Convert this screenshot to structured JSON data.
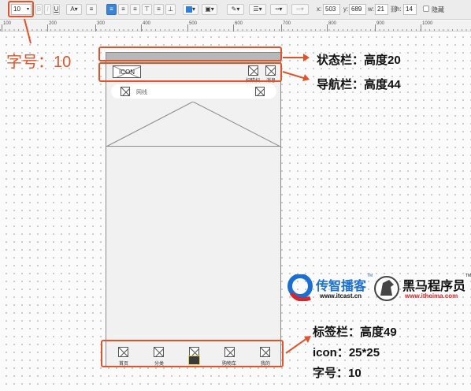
{
  "toolbar": {
    "font_size_value": "10",
    "x_label": "x:",
    "x_value": "503",
    "y_label": "y:",
    "y_value": "689",
    "w_label": "w:",
    "w_value": "21",
    "h_label": "h:",
    "h_value": "14",
    "hide_label": "隐藏"
  },
  "ruler": {
    "marks": [
      "100",
      "200",
      "300",
      "400",
      "500",
      "600",
      "700",
      "800",
      "900",
      "1000"
    ]
  },
  "canvas": {
    "icon_label": "ICON",
    "scan_label": "扫瞄扫",
    "message_label": "消息",
    "search_placeholder": "网线",
    "tabs": [
      {
        "label": "首页"
      },
      {
        "label": "分类"
      },
      {
        "label": ""
      },
      {
        "label": "购物车"
      },
      {
        "label": "我的"
      }
    ]
  },
  "annotations": {
    "font_size_note": "字号：10",
    "status_bar_note": "状态栏：高度20",
    "nav_bar_note": "导航栏：高度44",
    "tab_bar_note": "标签栏：高度49",
    "icon_note": "icon：25*25",
    "tab_font_note": "字号：10"
  },
  "logos": {
    "itcast_name": "传智播客",
    "itcast_tm": "TM",
    "itcast_url": "www.itcast.cn",
    "itheima_name": "黑马程序员",
    "itheima_tm": "TM",
    "itheima_url": "www.itheima.com"
  },
  "colors": {
    "accent": "#e2532a",
    "selection": "#3b83d6",
    "logo_blue": "#1a6fd4",
    "logo_red": "#d9262b"
  }
}
